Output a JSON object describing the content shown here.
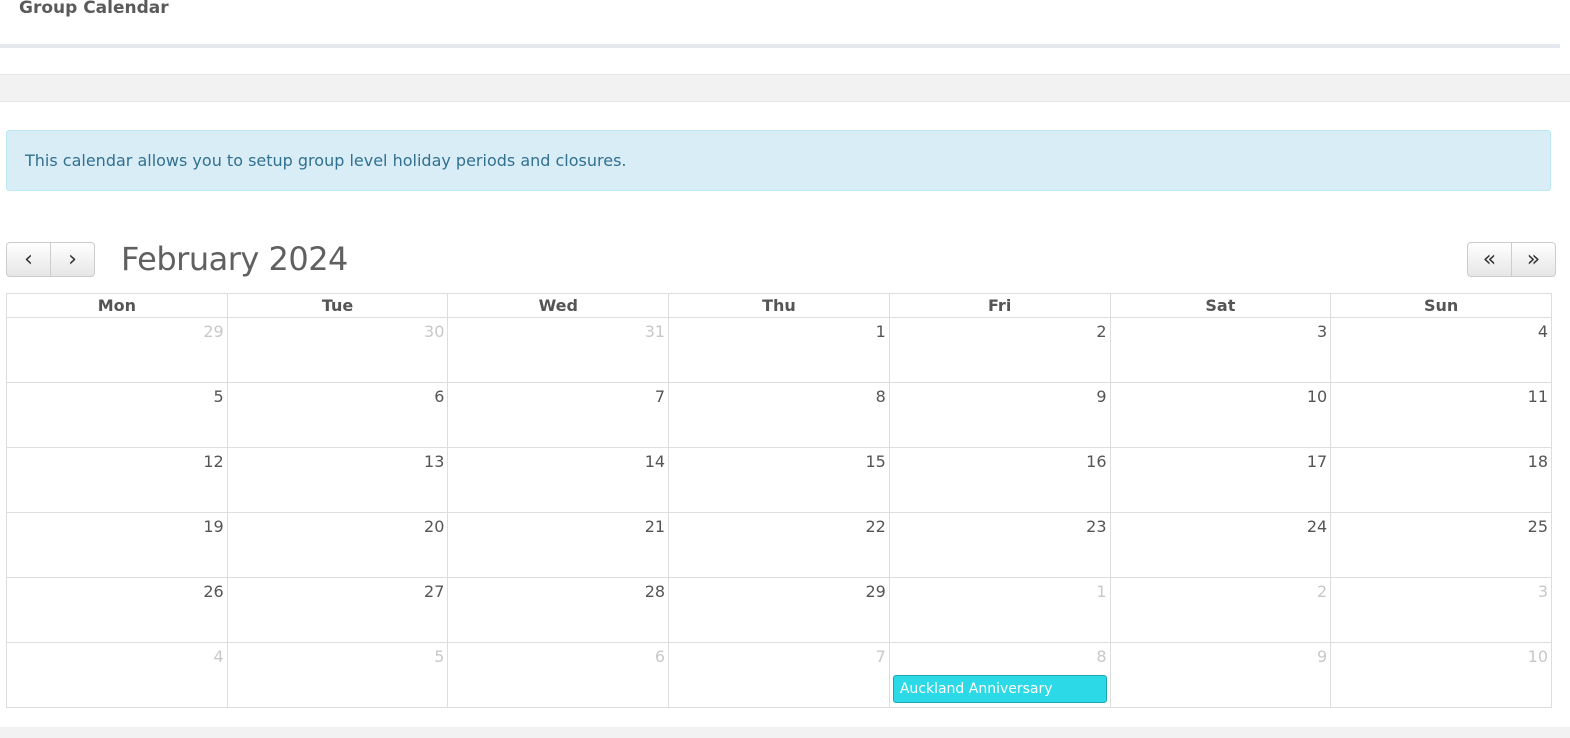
{
  "header": {
    "title": "Group Calendar"
  },
  "alert": {
    "text": "This calendar allows you to setup group level holiday periods and closures."
  },
  "calendar": {
    "title": "February 2024",
    "nav": {
      "prev": "‹",
      "next": "›",
      "prev_year": "«",
      "next_year": "»"
    },
    "weekdays": [
      "Mon",
      "Tue",
      "Wed",
      "Thu",
      "Fri",
      "Sat",
      "Sun"
    ],
    "weeks": [
      [
        {
          "day": "29",
          "other": true
        },
        {
          "day": "30",
          "other": true
        },
        {
          "day": "31",
          "other": true
        },
        {
          "day": "1",
          "other": false
        },
        {
          "day": "2",
          "other": false
        },
        {
          "day": "3",
          "other": false
        },
        {
          "day": "4",
          "other": false
        }
      ],
      [
        {
          "day": "5",
          "other": false
        },
        {
          "day": "6",
          "other": false
        },
        {
          "day": "7",
          "other": false
        },
        {
          "day": "8",
          "other": false
        },
        {
          "day": "9",
          "other": false
        },
        {
          "day": "10",
          "other": false
        },
        {
          "day": "11",
          "other": false
        }
      ],
      [
        {
          "day": "12",
          "other": false
        },
        {
          "day": "13",
          "other": false
        },
        {
          "day": "14",
          "other": false
        },
        {
          "day": "15",
          "other": false
        },
        {
          "day": "16",
          "other": false
        },
        {
          "day": "17",
          "other": false
        },
        {
          "day": "18",
          "other": false
        }
      ],
      [
        {
          "day": "19",
          "other": false
        },
        {
          "day": "20",
          "other": false
        },
        {
          "day": "21",
          "other": false
        },
        {
          "day": "22",
          "other": false
        },
        {
          "day": "23",
          "other": false
        },
        {
          "day": "24",
          "other": false
        },
        {
          "day": "25",
          "other": false
        }
      ],
      [
        {
          "day": "26",
          "other": false
        },
        {
          "day": "27",
          "other": false
        },
        {
          "day": "28",
          "other": false
        },
        {
          "day": "29",
          "other": false
        },
        {
          "day": "1",
          "other": true
        },
        {
          "day": "2",
          "other": true
        },
        {
          "day": "3",
          "other": true
        }
      ],
      [
        {
          "day": "4",
          "other": true
        },
        {
          "day": "5",
          "other": true
        },
        {
          "day": "6",
          "other": true
        },
        {
          "day": "7",
          "other": true
        },
        {
          "day": "8",
          "other": true,
          "event": "Auckland Anniversary"
        },
        {
          "day": "9",
          "other": true
        },
        {
          "day": "10",
          "other": true
        }
      ]
    ],
    "colors": {
      "event": "#2cd9e6",
      "other_month": "#c8c8c8"
    }
  }
}
